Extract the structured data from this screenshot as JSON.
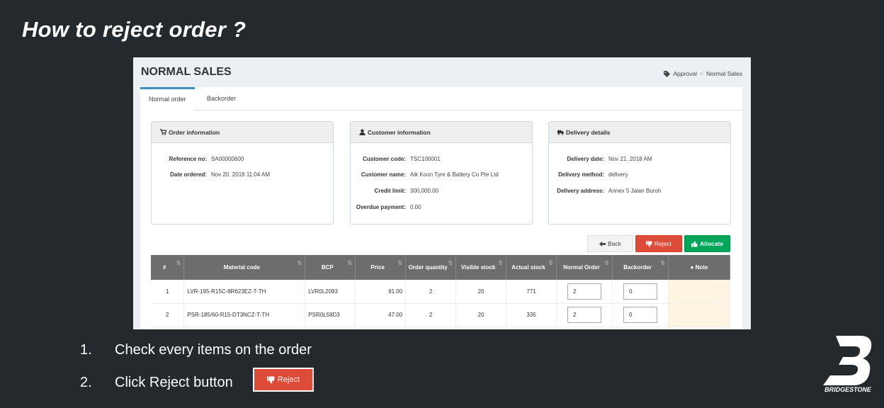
{
  "slide": {
    "title": "How to reject order ?",
    "steps": [
      {
        "num": "1.",
        "text": "Check every items on the order"
      },
      {
        "num": "2.",
        "text": "Click Reject button"
      }
    ],
    "reject_sample_label": "Reject",
    "brand": "BRIDGESTONE"
  },
  "app": {
    "page_title": "NORMAL SALES",
    "breadcrumb": [
      "Approval",
      "Normal Sales"
    ],
    "tabs": [
      "Normal order",
      "Backorder"
    ],
    "order_info": {
      "title": "Order information",
      "ref_label": "Reference no:",
      "ref_value": "SA00000600",
      "date_label": "Date ordered:",
      "date_value": "Nov 20, 2018 11:04 AM"
    },
    "customer_info": {
      "title": "Customer information",
      "code_label": "Customer code:",
      "code_value": "TSC100001",
      "name_label": "Customer name:",
      "name_value": "Aik Koon Tyre & Battery Co Pte Ltd",
      "credit_label": "Credit limit:",
      "credit_value": "300,000.00",
      "overdue_label": "Overdue payment:",
      "overdue_value": "0.00"
    },
    "delivery_info": {
      "title": "Delivery details",
      "date_label": "Delivery date:",
      "date_value": "Nov 21, 2018 AM",
      "method_label": "Delivery method:",
      "method_value": "delivery",
      "address_label": "Delivery address:",
      "address_value": "Annex 5 Jalan Buroh"
    },
    "buttons": {
      "back": "Back",
      "reject": "Reject",
      "allocate": "Allocate"
    },
    "table": {
      "headers": [
        "#",
        "Material code",
        "BCP",
        "Price",
        "Order quantity",
        "Visible stock",
        "Actual stock",
        "Normal Order",
        "Backorder",
        "Note"
      ],
      "rows": [
        {
          "no": "1",
          "material": "LVR-195-R15C-8R623EZ-T-TH",
          "bcp": "LVR0L2093",
          "price": "91.00",
          "qty": "2",
          "visible": "20",
          "actual": "771",
          "normal": "2",
          "backorder": "0",
          "note": ""
        },
        {
          "no": "2",
          "material": "PSR-185/60-R15-DT3NCZ-T-TH",
          "bcp": "PSR0L58D3",
          "price": "47.00",
          "qty": "2",
          "visible": "20",
          "actual": "335",
          "normal": "2",
          "backorder": "0",
          "note": ""
        }
      ]
    }
  }
}
